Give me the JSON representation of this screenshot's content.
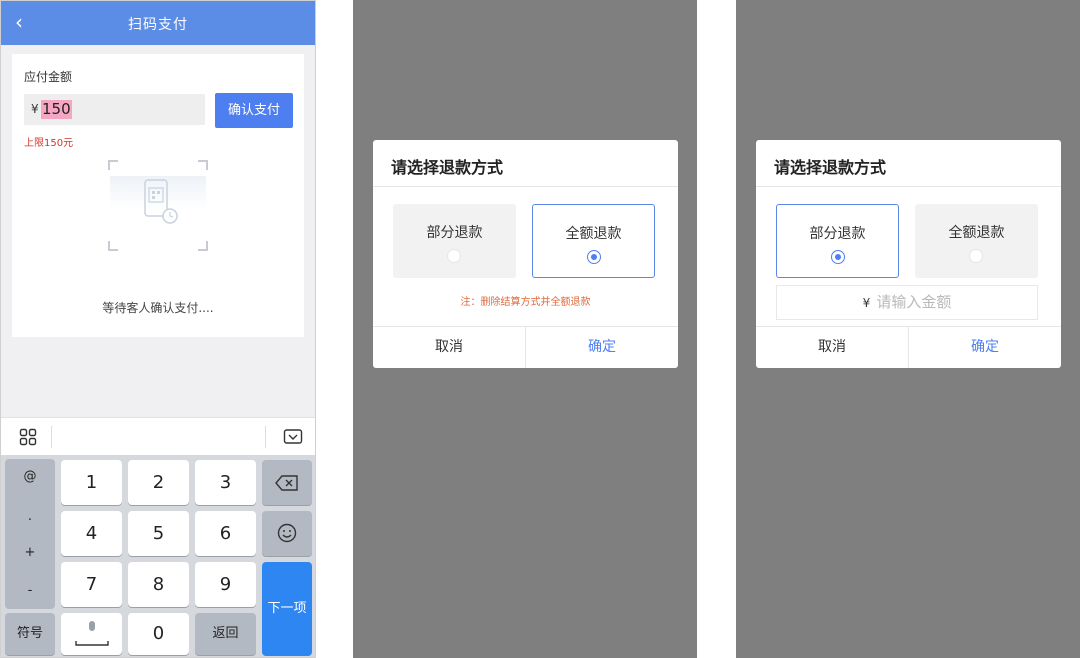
{
  "screen1": {
    "title": "扫码支付",
    "amount_label": "应付金额",
    "currency": "¥",
    "amount_value": "150",
    "confirm_button": "确认支付",
    "limit_text": "上限150元",
    "waiting_text": "等待客人确认支付....",
    "keyboard": {
      "symbols": [
        "@",
        ".",
        "+",
        "-"
      ],
      "keys": [
        "1",
        "2",
        "3",
        "4",
        "5",
        "6",
        "7",
        "8",
        "9",
        "0"
      ],
      "symbol_key": "符号",
      "return_key": "返回",
      "next_key": "下一项"
    }
  },
  "dialog_full": {
    "title": "请选择退款方式",
    "option_partial": "部分退款",
    "option_full": "全额退款",
    "selected": "全额退款",
    "note": "注：删除结算方式并全额退款",
    "cancel": "取消",
    "confirm": "确定"
  },
  "dialog_partial": {
    "title": "请选择退款方式",
    "option_partial": "部分退款",
    "option_full": "全额退款",
    "selected": "部分退款",
    "currency": "¥",
    "amount_placeholder": "请输入金额",
    "cancel": "取消",
    "confirm": "确定"
  },
  "colors": {
    "header_blue": "#5b8de6",
    "button_blue": "#4e7ff0",
    "next_blue": "#2e86f2",
    "limit_red": "#d9342b",
    "note_orange": "#e06a3b",
    "overlay_gray": "#7f7f7f"
  },
  "icons": [
    "back-chevron-icon",
    "qr-scan-icon",
    "apps-grid-icon",
    "keyboard-hide-icon",
    "backspace-icon",
    "emoji-icon",
    "microphone-icon"
  ]
}
